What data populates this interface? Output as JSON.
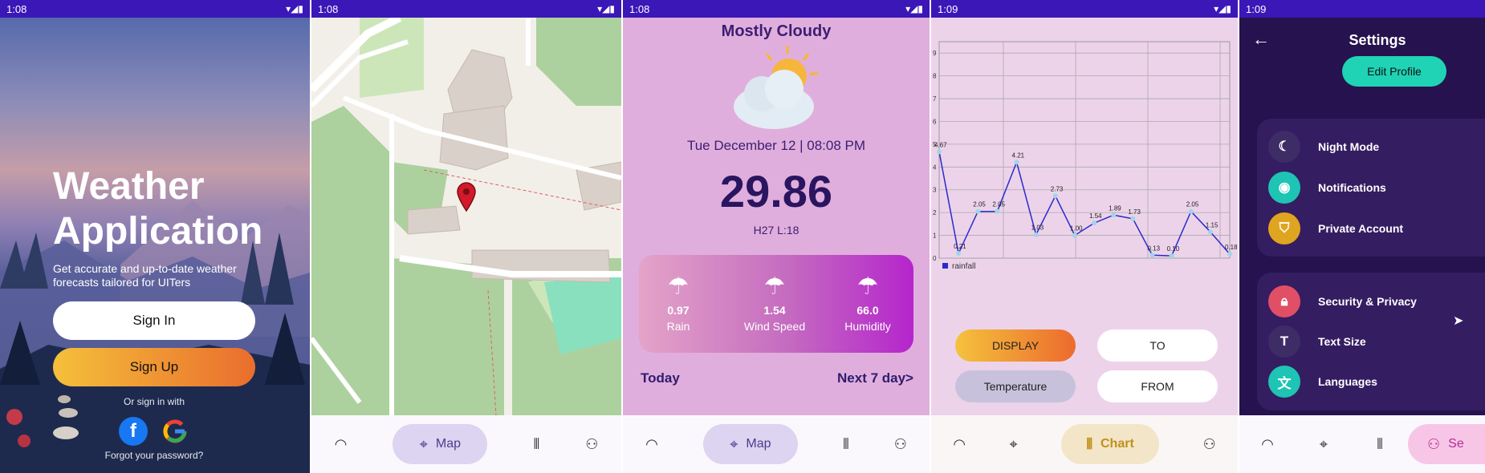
{
  "status_bars": [
    "1:08",
    "1:08",
    "1:08",
    "1:09",
    "1:09"
  ],
  "panel1": {
    "title_line1": "Weather",
    "title_line2": "Application",
    "subtitle": "Get accurate and up-to-date weather forecasts tailored for UITers",
    "sign_in": "Sign In",
    "sign_up": "Sign Up",
    "or_sign_in": "Or sign in with",
    "forgot": "Forgot your password?",
    "colors": {
      "sign_up_gradient": [
        "#f4c03a",
        "#ea6d2e"
      ]
    }
  },
  "panel2": {
    "nav": {
      "map_label": "Map"
    }
  },
  "panel3": {
    "condition": "Mostly Cloudy",
    "datetime": "Tue December 12 | 08:08 PM",
    "temperature": "29.86",
    "high_low": "H27 L:18",
    "metrics": [
      {
        "value": "0.97",
        "label": "Rain"
      },
      {
        "value": "1.54",
        "label": "Wind Speed"
      },
      {
        "value": "66.0",
        "label": "Humiditly"
      }
    ],
    "today": "Today",
    "next_days": "Next 7 day>",
    "nav": {
      "map_label": "Map"
    }
  },
  "panel4": {
    "buttons": {
      "display": "DISPLAY",
      "to": "TO",
      "temperature": "Temperature",
      "from": "FROM"
    },
    "nav": {
      "chart_label": "Chart"
    }
  },
  "chart_data": {
    "type": "line",
    "series": [
      {
        "name": "rainfall",
        "values": [
          4.67,
          0.21,
          2.05,
          2.05,
          4.21,
          1.03,
          2.73,
          1.0,
          1.54,
          1.89,
          1.73,
          0.13,
          0.1,
          2.05,
          1.15,
          0.18
        ],
        "labels": [
          "4.67",
          "0.21",
          "2.05",
          "2.05",
          "4.21",
          "1.03",
          "2.73",
          "1.00",
          "1.54",
          "1.89",
          "1.73",
          "0.13",
          "0.10",
          "2.05",
          "1.15",
          "0.18"
        ]
      }
    ],
    "y_ticks": [
      "0",
      "1",
      "2",
      "3",
      "4",
      "5",
      "6",
      "7",
      "8",
      "9"
    ],
    "ylim": [
      0,
      9.5
    ],
    "legend": "bottom-left",
    "grid": true,
    "line_color": "#2a2acb"
  },
  "panel5": {
    "title": "Settings",
    "edit_profile": "Edit Profile",
    "group1": [
      "Night Mode",
      "Notifications",
      "Private Account"
    ],
    "group2": [
      "Security & Privacy",
      "Text Size",
      "Languages"
    ],
    "nav_partial": "Se",
    "icon_colors": [
      "#3d2c66",
      "#1ec4b4",
      "#e0a520",
      "#e04f66",
      "#3d2c66",
      "#1ec4b4"
    ]
  }
}
